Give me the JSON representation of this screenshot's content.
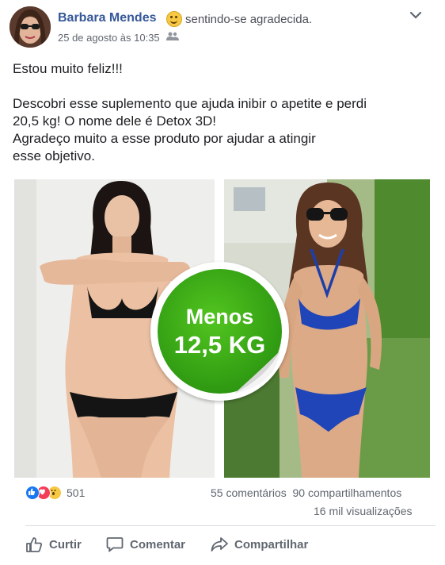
{
  "post": {
    "author": "Barbara Mendes",
    "feeling": "sentindo-se agradecida.",
    "feeling_icon": "smiling-emoji-icon",
    "timestamp": "25 de agosto às 10:35",
    "privacy_icon": "friends-icon",
    "text_lines": {
      "line1": "Estou muito feliz!!!",
      "line2": "Descobri esse suplemento que ajuda inibir o apetite e perdi",
      "line3": "20,5 kg! O nome dele é Detox 3D!",
      "line4": "Agradeço muito a esse produto por ajudar a atingir",
      "line5": "esse objetivo."
    },
    "badge": {
      "line1": "Menos",
      "line2": "12,5 KG"
    }
  },
  "stats": {
    "reaction_count": "501",
    "comments": "55 comentários",
    "shares": "90 compartilhamentos",
    "views": "16 mil visualizações"
  },
  "actions": {
    "like": "Curtir",
    "comment": "Comentar",
    "share": "Compartilhar"
  },
  "colors": {
    "author_link": "#365899",
    "badge_green": "#2f9a12",
    "like_blue": "#1877f2",
    "love_red": "#f33e58",
    "wow_yellow": "#f7c843"
  }
}
